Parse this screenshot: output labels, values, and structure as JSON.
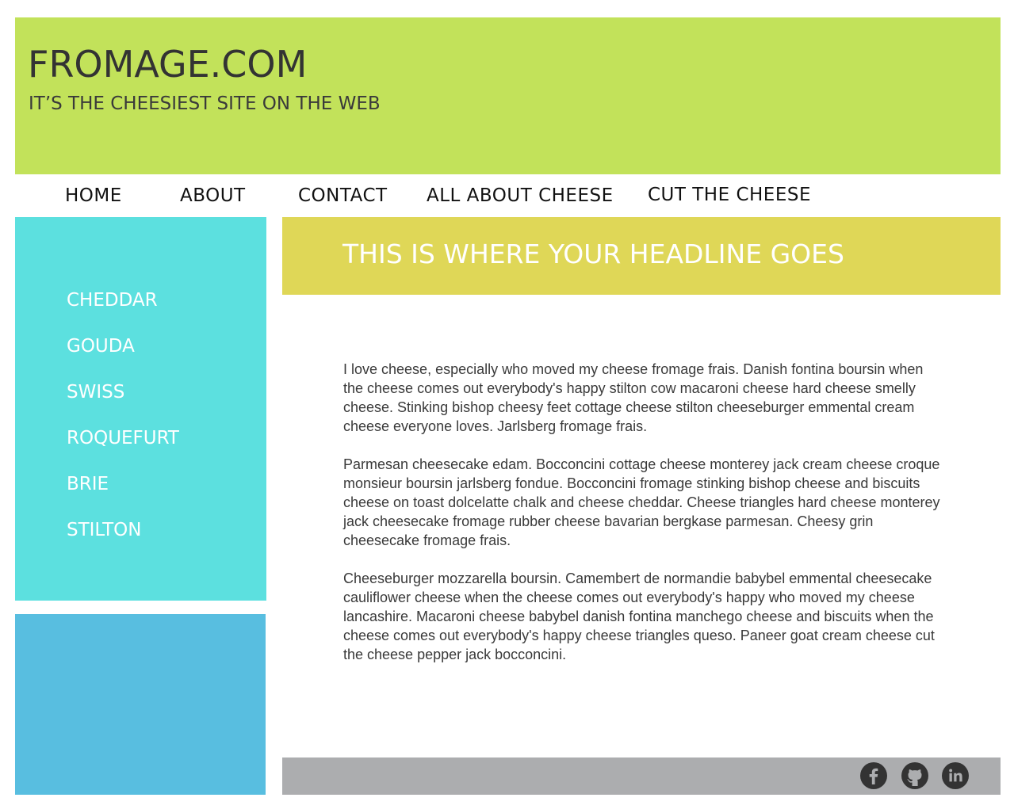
{
  "header": {
    "title": "FROMAGE.COM",
    "tagline": "IT’S THE CHEESIEST SITE ON THE WEB"
  },
  "nav": {
    "items": [
      {
        "label": "HOME"
      },
      {
        "label": "ABOUT"
      },
      {
        "label": "CONTACT"
      },
      {
        "label": "ALL ABOUT CHEESE"
      },
      {
        "label": "CUT THE CHEESE"
      }
    ]
  },
  "sidebar": {
    "items": [
      {
        "label": "CHEDDAR"
      },
      {
        "label": "GOUDA"
      },
      {
        "label": "SWISS"
      },
      {
        "label": "ROQUEFURT"
      },
      {
        "label": "BRIE"
      },
      {
        "label": "STILTON"
      }
    ]
  },
  "main": {
    "headline": "THIS IS WHERE YOUR HEADLINE GOES",
    "paragraphs": [
      "I love cheese, especially who moved my cheese fromage frais. Danish fontina boursin when the cheese comes out everybody's happy stilton cow macaroni cheese hard cheese smelly cheese. Stinking bishop cheesy feet cottage cheese stilton cheeseburger emmental cream cheese everyone loves. Jarlsberg fromage frais.",
      "Parmesan cheesecake edam. Bocconcini cottage cheese monterey jack cream cheese croque monsieur boursin jarlsberg fondue. Bocconcini fromage stinking bishop cheese and biscuits cheese on toast dolcelatte chalk and cheese cheddar. Cheese triangles hard cheese monterey jack cheesecake fromage rubber cheese bavarian bergkase parmesan. Cheesy grin cheesecake fromage frais.",
      "Cheeseburger mozzarella boursin. Camembert de normandie babybel emmental cheesecake cauliflower cheese when the cheese comes out everybody's happy who moved my cheese lancashire. Macaroni cheese babybel danish fontina manchego cheese and biscuits when the cheese comes out everybody's happy cheese triangles queso. Paneer goat cream cheese cut the cheese pepper jack bocconcini."
    ]
  },
  "footer": {
    "icons": [
      "facebook-icon",
      "github-icon",
      "linkedin-icon"
    ]
  },
  "colors": {
    "header_bg": "#c2e25a",
    "sidebar_bg": "#5ce0df",
    "sidebox_bg": "#58bee0",
    "headline_bg": "#dfd757",
    "footer_bg": "#acadaf",
    "icon_bg": "#333333"
  }
}
